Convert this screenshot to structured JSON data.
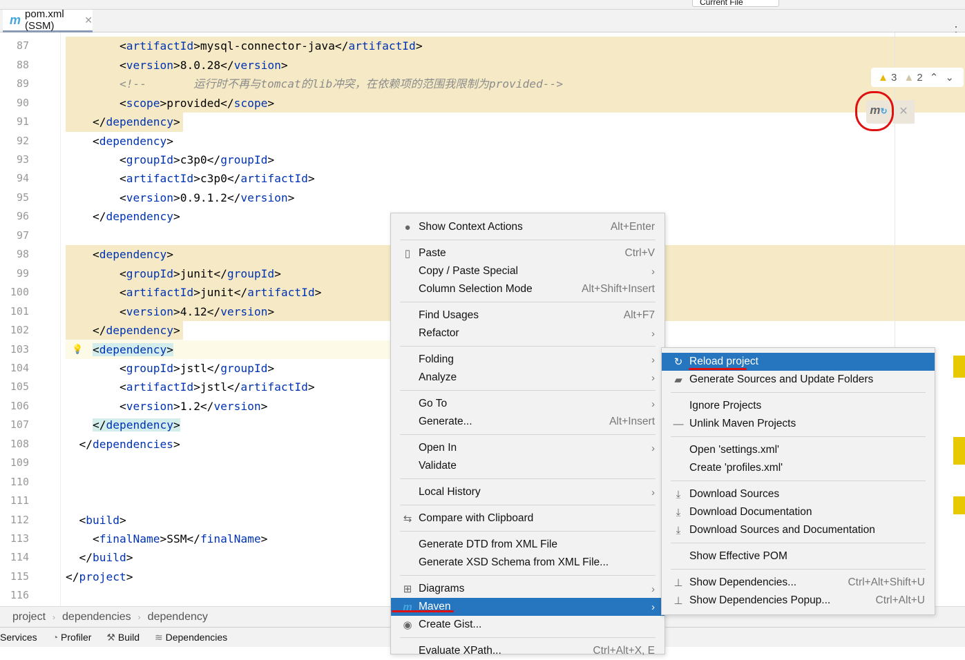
{
  "top": {
    "current_file": "Current File"
  },
  "tab": {
    "icon": "maven-icon",
    "label": "pom.xml (SSM)"
  },
  "inspections": {
    "warnings": "3",
    "weak_warnings": "2"
  },
  "code_lines": [
    {
      "n": "87",
      "text": "        <artifactId>mysql-connector-java</artifactId>"
    },
    {
      "n": "88",
      "text": "        <version>8.0.28</version>"
    },
    {
      "n": "89",
      "text": "        <!--       运行时不再与tomcat的lib冲突，在依赖项的范围我限制为provided-->",
      "comment": true
    },
    {
      "n": "90",
      "text": "        <scope>provided</scope>"
    },
    {
      "n": "91",
      "text": "    </dependency>"
    },
    {
      "n": "92",
      "text": "    <dependency>"
    },
    {
      "n": "93",
      "text": "        <groupId>c3p0</groupId>"
    },
    {
      "n": "94",
      "text": "        <artifactId>c3p0</artifactId>"
    },
    {
      "n": "95",
      "text": "        <version>0.9.1.2</version>"
    },
    {
      "n": "96",
      "text": "    </dependency>"
    },
    {
      "n": "97",
      "text": ""
    },
    {
      "n": "98",
      "text": "    <dependency>"
    },
    {
      "n": "99",
      "text": "        <groupId>junit</groupId>"
    },
    {
      "n": "100",
      "text": "        <artifactId>junit</artifactId>"
    },
    {
      "n": "101",
      "text": "        <version>4.12</version>"
    },
    {
      "n": "102",
      "text": "    </dependency>"
    },
    {
      "n": "103",
      "text": "    <dependency>"
    },
    {
      "n": "104",
      "text": "        <groupId>jstl</groupId>"
    },
    {
      "n": "105",
      "text": "        <artifactId>jstl</artifactId>"
    },
    {
      "n": "106",
      "text": "        <version>1.2</version>"
    },
    {
      "n": "107",
      "text": "    </dependency>"
    },
    {
      "n": "108",
      "text": "  </dependencies>"
    },
    {
      "n": "109",
      "text": ""
    },
    {
      "n": "110",
      "text": ""
    },
    {
      "n": "111",
      "text": ""
    },
    {
      "n": "112",
      "text": "  <build>"
    },
    {
      "n": "113",
      "text": "    <finalName>SSM</finalName>"
    },
    {
      "n": "114",
      "text": "  </build>"
    },
    {
      "n": "115",
      "text": "</project>"
    },
    {
      "n": "116",
      "text": ""
    }
  ],
  "breadcrumb": [
    "project",
    "dependencies",
    "dependency"
  ],
  "toolwindows": [
    {
      "label": "Services",
      "icon": ""
    },
    {
      "label": "Profiler",
      "icon": "profiler-icon"
    },
    {
      "label": "Build",
      "icon": "hammer-icon"
    },
    {
      "label": "Dependencies",
      "icon": "layers-icon"
    }
  ],
  "context_menu": [
    {
      "label": "Show Context Actions",
      "shortcut": "Alt+Enter",
      "icon": "bulb-icon"
    },
    {
      "sep": true
    },
    {
      "label": "Paste",
      "shortcut": "Ctrl+V",
      "icon": "clipboard-icon"
    },
    {
      "label": "Copy / Paste Special",
      "submenu": true
    },
    {
      "label": "Column Selection Mode",
      "shortcut": "Alt+Shift+Insert"
    },
    {
      "sep": true
    },
    {
      "label": "Find Usages",
      "shortcut": "Alt+F7"
    },
    {
      "label": "Refactor",
      "submenu": true
    },
    {
      "sep": true
    },
    {
      "label": "Folding",
      "submenu": true
    },
    {
      "label": "Analyze",
      "submenu": true
    },
    {
      "sep": true
    },
    {
      "label": "Go To",
      "submenu": true
    },
    {
      "label": "Generate...",
      "shortcut": "Alt+Insert"
    },
    {
      "sep": true
    },
    {
      "label": "Open In",
      "submenu": true
    },
    {
      "label": "Validate"
    },
    {
      "sep": true
    },
    {
      "label": "Local History",
      "submenu": true
    },
    {
      "sep": true
    },
    {
      "label": "Compare with Clipboard",
      "icon": "compare-icon"
    },
    {
      "sep": true
    },
    {
      "label": "Generate DTD from XML File"
    },
    {
      "label": "Generate XSD Schema from XML File..."
    },
    {
      "sep": true
    },
    {
      "label": "Diagrams",
      "submenu": true,
      "icon": "diagram-icon"
    },
    {
      "label": "Maven",
      "submenu": true,
      "icon": "maven-icon",
      "selected": true
    },
    {
      "label": "Create Gist...",
      "icon": "github-icon"
    },
    {
      "sep": true
    },
    {
      "label": "Evaluate XPath...",
      "shortcut": "Ctrl+Alt+X, E"
    }
  ],
  "maven_submenu": [
    {
      "label": "Reload project",
      "icon": "reload-icon",
      "selected": true
    },
    {
      "label": "Generate Sources and Update Folders",
      "icon": "folder-refresh-icon"
    },
    {
      "sep": true
    },
    {
      "label": "Ignore Projects"
    },
    {
      "label": "Unlink Maven Projects",
      "icon": "minus-icon"
    },
    {
      "sep": true
    },
    {
      "label": "Open 'settings.xml'"
    },
    {
      "label": "Create 'profiles.xml'"
    },
    {
      "sep": true
    },
    {
      "label": "Download Sources",
      "icon": "download-icon"
    },
    {
      "label": "Download Documentation",
      "icon": "download-icon"
    },
    {
      "label": "Download Sources and Documentation",
      "icon": "download-icon"
    },
    {
      "sep": true
    },
    {
      "label": "Show Effective POM"
    },
    {
      "sep": true
    },
    {
      "label": "Show Dependencies...",
      "shortcut": "Ctrl+Alt+Shift+U",
      "icon": "dependencies-icon"
    },
    {
      "label": "Show Dependencies Popup...",
      "shortcut": "Ctrl+Alt+U",
      "icon": "dependencies-icon"
    }
  ],
  "colors": {
    "selection": "#2675bf",
    "highlight": "#f5eac5",
    "tag": "#0033b3",
    "annotation": "#e01010"
  }
}
